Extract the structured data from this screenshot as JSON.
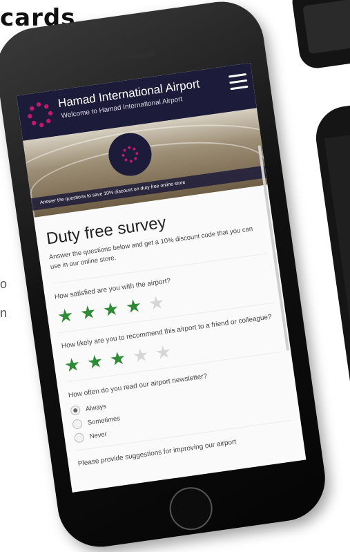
{
  "page": {
    "heading_fragment": "cards",
    "side_text": [
      "o",
      "n"
    ]
  },
  "app": {
    "title": "Hamad International Airport",
    "subtitle": "Welcome to Hamad International Airport",
    "brand_color": "#1c1b3a",
    "accent_color": "#2d8a35"
  },
  "hero": {
    "caption": "Answer the questions to save 10% discount on duty free online store"
  },
  "survey": {
    "title": "Duty free survey",
    "intro": "Answer the questions below and get a 10% discount code that you can use in our online store.",
    "questions": [
      {
        "text": "How satisfied are you with the airport?",
        "rating": 4,
        "max": 5
      },
      {
        "text": "How likely are you to recommend this airport to a friend or colleague?",
        "rating": 3,
        "max": 5
      },
      {
        "text": "How often do you read our airport newsletter?",
        "options": [
          "Always",
          "Sometimes",
          "Never"
        ],
        "selected": "Always"
      },
      {
        "text": "Please provide suggestions for improving our airport"
      }
    ]
  }
}
